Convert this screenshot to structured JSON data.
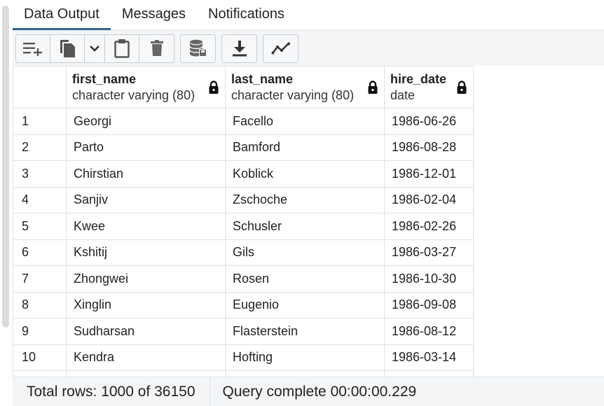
{
  "tabs": [
    {
      "label": "Data Output",
      "active": true
    },
    {
      "label": "Messages",
      "active": false
    },
    {
      "label": "Notifications",
      "active": false
    }
  ],
  "toolbar": {
    "buttons": [
      "add-row-icon",
      "copy-icon",
      "chevron-down-icon",
      "paste-icon",
      "delete-icon",
      "save-data-icon",
      "download-icon",
      "graph-visualiser-icon"
    ]
  },
  "grid": {
    "columns": [
      {
        "name": "first_name",
        "type": "character varying (80)"
      },
      {
        "name": "last_name",
        "type": "character varying (80)"
      },
      {
        "name": "hire_date",
        "type": "date"
      }
    ],
    "rows": [
      [
        "1",
        "Georgi",
        "Facello",
        "1986-06-26"
      ],
      [
        "2",
        "Parto",
        "Bamford",
        "1986-08-28"
      ],
      [
        "3",
        "Chirstian",
        "Koblick",
        "1986-12-01"
      ],
      [
        "4",
        "Sanjiv",
        "Zschoche",
        "1986-02-04"
      ],
      [
        "5",
        "Kwee",
        "Schusler",
        "1986-02-26"
      ],
      [
        "6",
        "Kshitij",
        "Gils",
        "1986-03-27"
      ],
      [
        "7",
        "Zhongwei",
        "Rosen",
        "1986-10-30"
      ],
      [
        "8",
        "Xinglin",
        "Eugenio",
        "1986-09-08"
      ],
      [
        "9",
        "Sudharsan",
        "Flasterstein",
        "1986-08-12"
      ],
      [
        "10",
        "Kendra",
        "Hofting",
        "1986-03-14"
      ]
    ]
  },
  "status": {
    "total_rows": "Total rows: 1000 of 36150",
    "query": "Query complete 00:00:00.229"
  },
  "colors": {
    "accent": "#326690",
    "toolbar_bg": "#f3f5f7",
    "border": "#dee2e6"
  }
}
